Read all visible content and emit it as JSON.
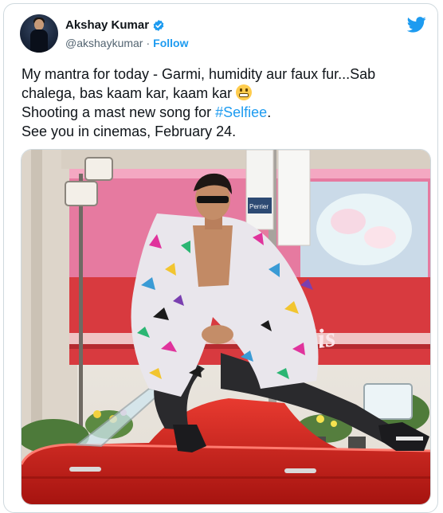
{
  "author": {
    "display_name": "Akshay Kumar",
    "handle": "@akshaykumar",
    "separator": "·",
    "follow_label": "Follow"
  },
  "tweet": {
    "line1": "My mantra for today - Garmi, humidity aur faux fur...Sab chalega, bas kaam kar, kaam kar",
    "line2_prefix": "Shooting a mast new song for ",
    "hashtag": "#Selfiee",
    "line2_suffix": ".",
    "line3": "See you in cinemas, February 24."
  },
  "media": {
    "shop_sign": "polis",
    "pole_sign": "Perrier"
  },
  "colors": {
    "accent": "#1d9bf0",
    "text": "#0f1419",
    "muted": "#536471",
    "car_red": "#d2221f"
  },
  "icons": [
    "verified-badge-icon",
    "twitter-bird-icon",
    "grimacing-emoji-icon"
  ]
}
